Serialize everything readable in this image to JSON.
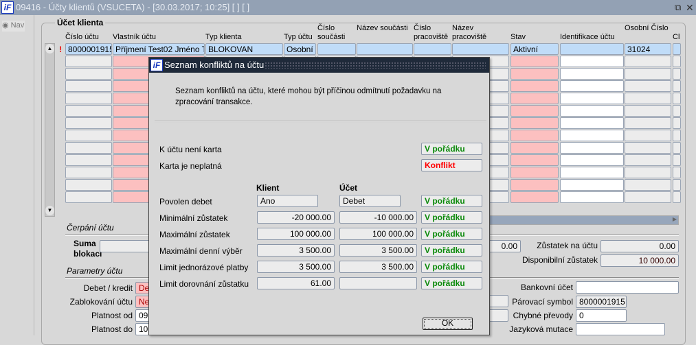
{
  "window": {
    "title": "09416 - Účty klientů (VSUCETA) - [30.03.2017; 10:25]  [ ]  [ ]",
    "restore_icon": "restore-icon",
    "close_icon": "close-icon"
  },
  "nav": {
    "label": "Nav"
  },
  "group": {
    "title": "Účet klienta"
  },
  "grid": {
    "columns": [
      "Číslo účtu",
      "Vlastník účtu",
      "Typ klienta",
      "Typ účtu",
      "Číslo součásti",
      "Název součásti",
      "Číslo pracoviště",
      "Název pracoviště",
      "Stav",
      "Identifikace účtu",
      "Osobní Číslo",
      "Cl"
    ],
    "marker": "!",
    "rows": [
      [
        "8000001915",
        "Příjmení Test02 Jméno Test",
        "BLOKOVAN",
        "Osobní",
        "",
        "",
        "",
        "",
        "Aktivní",
        "",
        "31024",
        ""
      ]
    ]
  },
  "cerpani": {
    "title": "Čerpání účtu",
    "suma_blokaci_label": "Suma blokací",
    "suma_blokaci": "",
    "field_value": "0.00",
    "zustatek_label": "Zůstatek na účtu",
    "zustatek": "0.00",
    "disponibilni_label": "Disponibilní zůstatek",
    "disponibilni": "10 000.00"
  },
  "parametry": {
    "title": "Parametry účtu",
    "debet_label": "Debet / kredit",
    "debet": "Deb",
    "zablokovani_label": "Zablokování účtu",
    "zablokovani": "Ne",
    "platnost_od_label": "Platnost od",
    "platnost_od": "09.",
    "platnost_do_label": "Platnost do",
    "platnost_do": "10.",
    "bankovni_label": "Bankovní účet",
    "bankovni": "",
    "parovaci_label": "Párovací symbol",
    "parovaci": "8000001915",
    "chybne_label": "Chybné převody",
    "chybne": "0",
    "jazykova_label": "Jazyková mutace",
    "jazykova": ""
  },
  "dialog": {
    "title": "Seznam konfliktů na účtu",
    "description": "Seznam konfliktů na účtu, které mohou být příčinou odmítnutí požadavku na zpracování transakce.",
    "card_checks": [
      {
        "label": "K účtu není karta",
        "status": "V pořádku",
        "ok": true
      },
      {
        "label": "Karta je neplatná",
        "status": "Konflikt",
        "ok": false
      }
    ],
    "col_klient": "Klient",
    "col_ucet": "Účet",
    "rows": [
      {
        "label": "Povolen debet",
        "klient": "Ano",
        "ucet": "Debet",
        "status": "V pořádku",
        "align": "left"
      },
      {
        "label": "Minimální zůstatek",
        "klient": "-20 000.00",
        "ucet": "-10 000.00",
        "status": "V pořádku"
      },
      {
        "label": "Maximální zůstatek",
        "klient": "100 000.00",
        "ucet": "100 000.00",
        "status": "V pořádku"
      },
      {
        "label": "Maximální denní výběr",
        "klient": "3 500.00",
        "ucet": "3 500.00",
        "status": "V pořádku"
      },
      {
        "label": "Limit jednorázové platby",
        "klient": "3 500.00",
        "ucet": "3 500.00",
        "status": "V pořádku"
      },
      {
        "label": "Limit dorovnání zůstatku",
        "klient": "61.00",
        "ucet": "",
        "status": "V pořádku"
      }
    ],
    "ok_button": "OK"
  },
  "colors": {
    "title_bar": "#93a1b4",
    "dialog_title": "#1f2a3a",
    "selected_row": "#c0dcf8",
    "required": "#fcc0c0",
    "ok_status": "#0a8a0a",
    "conflict_status": "#ff0000"
  }
}
